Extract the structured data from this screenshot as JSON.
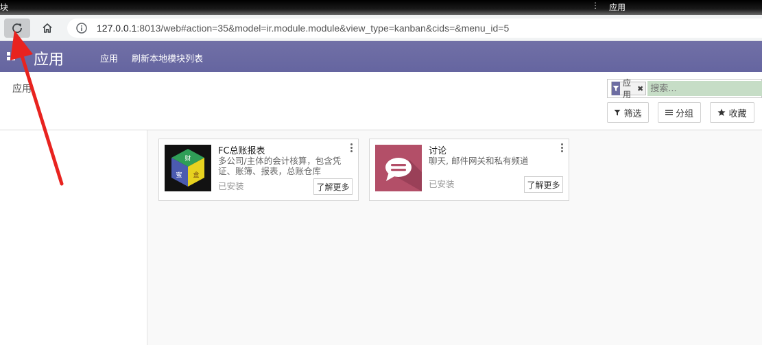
{
  "titlebar": {
    "left_text": "块",
    "right_text": "应用",
    "dots": "⋮"
  },
  "browser": {
    "url_host": "127.0.0.1",
    "url_rest": ":8013/web#action=35&model=ir.module.module&view_type=kanban&cids=&menu_id=5"
  },
  "navbar": {
    "brand": "应用",
    "menu": [
      "应用",
      "刷新本地模块列表"
    ]
  },
  "control_panel": {
    "breadcrumb": "应用",
    "search": {
      "facet_label": "应用",
      "facet_close": "✖",
      "placeholder": "搜索..."
    },
    "buttons": {
      "filter": "筛选",
      "group": "分组",
      "favorite": "收藏"
    }
  },
  "cards": [
    {
      "title": "FC总账报表",
      "description": "多公司/主体的会计核算，包含凭证、账簿、报表，总账仓库",
      "state": "已安装",
      "button": "了解更多",
      "logo_glyphs": [
        "财",
        "蜜",
        "盒"
      ]
    },
    {
      "title": "讨论",
      "description": "聊天, 邮件网关和私有频道",
      "state": "已安装",
      "button": "了解更多"
    }
  ],
  "colors": {
    "navbar": "#6a6aa0",
    "accent_green": "#c6ddc6",
    "arrow": "#e8231f",
    "discuss_tile": "#b34f68"
  },
  "icons": {
    "reload": "reload-icon",
    "home": "home-icon",
    "info": "info-icon",
    "filter": "filter-icon",
    "group": "list-icon",
    "favorite": "star-icon"
  }
}
